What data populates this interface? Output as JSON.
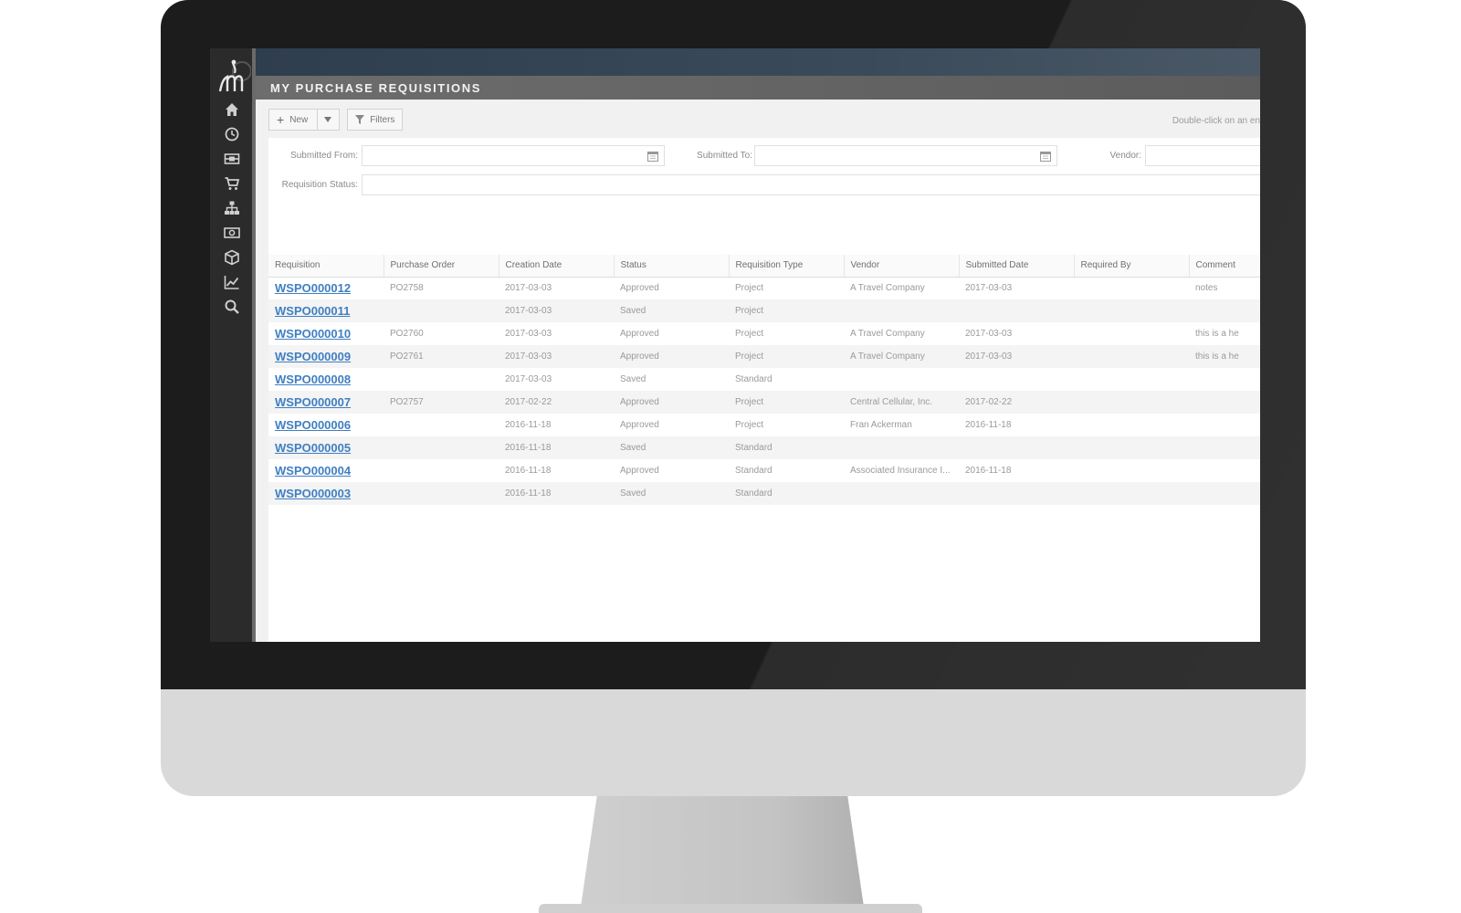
{
  "app": {
    "page_title": "MY PURCHASE REQUISITIONS"
  },
  "sidebar": {
    "items": [
      {
        "icon": "home-icon"
      },
      {
        "icon": "clock-icon"
      },
      {
        "icon": "card-icon"
      },
      {
        "icon": "cart-icon"
      },
      {
        "icon": "org-chart-icon"
      },
      {
        "icon": "money-icon"
      },
      {
        "icon": "box-icon"
      },
      {
        "icon": "chart-icon"
      },
      {
        "icon": "search-icon"
      }
    ]
  },
  "toolbar": {
    "new_label": "New",
    "filters_label": "Filters",
    "hint": "Double-click on an en"
  },
  "filters": {
    "submitted_from_label": "Submitted From:",
    "submitted_from_value": "",
    "submitted_to_label": "Submitted To:",
    "submitted_to_value": "",
    "vendor_label": "Vendor:",
    "vendor_value": "",
    "status_label": "Requisition Status:",
    "status_value": ""
  },
  "table": {
    "columns": [
      "Requisition",
      "Purchase Order",
      "Creation Date",
      "Status",
      "Requisition Type",
      "Vendor",
      "Submitted Date",
      "Required By",
      "Comment"
    ],
    "rows": [
      [
        "WSPO000012",
        "PO2758",
        "2017-03-03",
        "Approved",
        "Project",
        "A Travel Company",
        "2017-03-03",
        "",
        "notes"
      ],
      [
        "WSPO000011",
        "",
        "2017-03-03",
        "Saved",
        "Project",
        "",
        "",
        "",
        ""
      ],
      [
        "WSPO000010",
        "PO2760",
        "2017-03-03",
        "Approved",
        "Project",
        "A Travel Company",
        "2017-03-03",
        "",
        "this is a he"
      ],
      [
        "WSPO000009",
        "PO2761",
        "2017-03-03",
        "Approved",
        "Project",
        "A Travel Company",
        "2017-03-03",
        "",
        "this is a he"
      ],
      [
        "WSPO000008",
        "",
        "2017-03-03",
        "Saved",
        "Standard",
        "",
        "",
        "",
        ""
      ],
      [
        "WSPO000007",
        "PO2757",
        "2017-02-22",
        "Approved",
        "Project",
        "Central Cellular, Inc.",
        "2017-02-22",
        "",
        ""
      ],
      [
        "WSPO000006",
        "",
        "2016-11-18",
        "Approved",
        "Project",
        "Fran Ackerman",
        "2016-11-18",
        "",
        ""
      ],
      [
        "WSPO000005",
        "",
        "2016-11-18",
        "Saved",
        "Standard",
        "",
        "",
        "",
        ""
      ],
      [
        "WSPO000004",
        "",
        "2016-11-18",
        "Approved",
        "Standard",
        "Associated Insurance I...",
        "2016-11-18",
        "",
        ""
      ],
      [
        "WSPO000003",
        "",
        "2016-11-18",
        "Saved",
        "Standard",
        "",
        "",
        "",
        ""
      ]
    ]
  }
}
